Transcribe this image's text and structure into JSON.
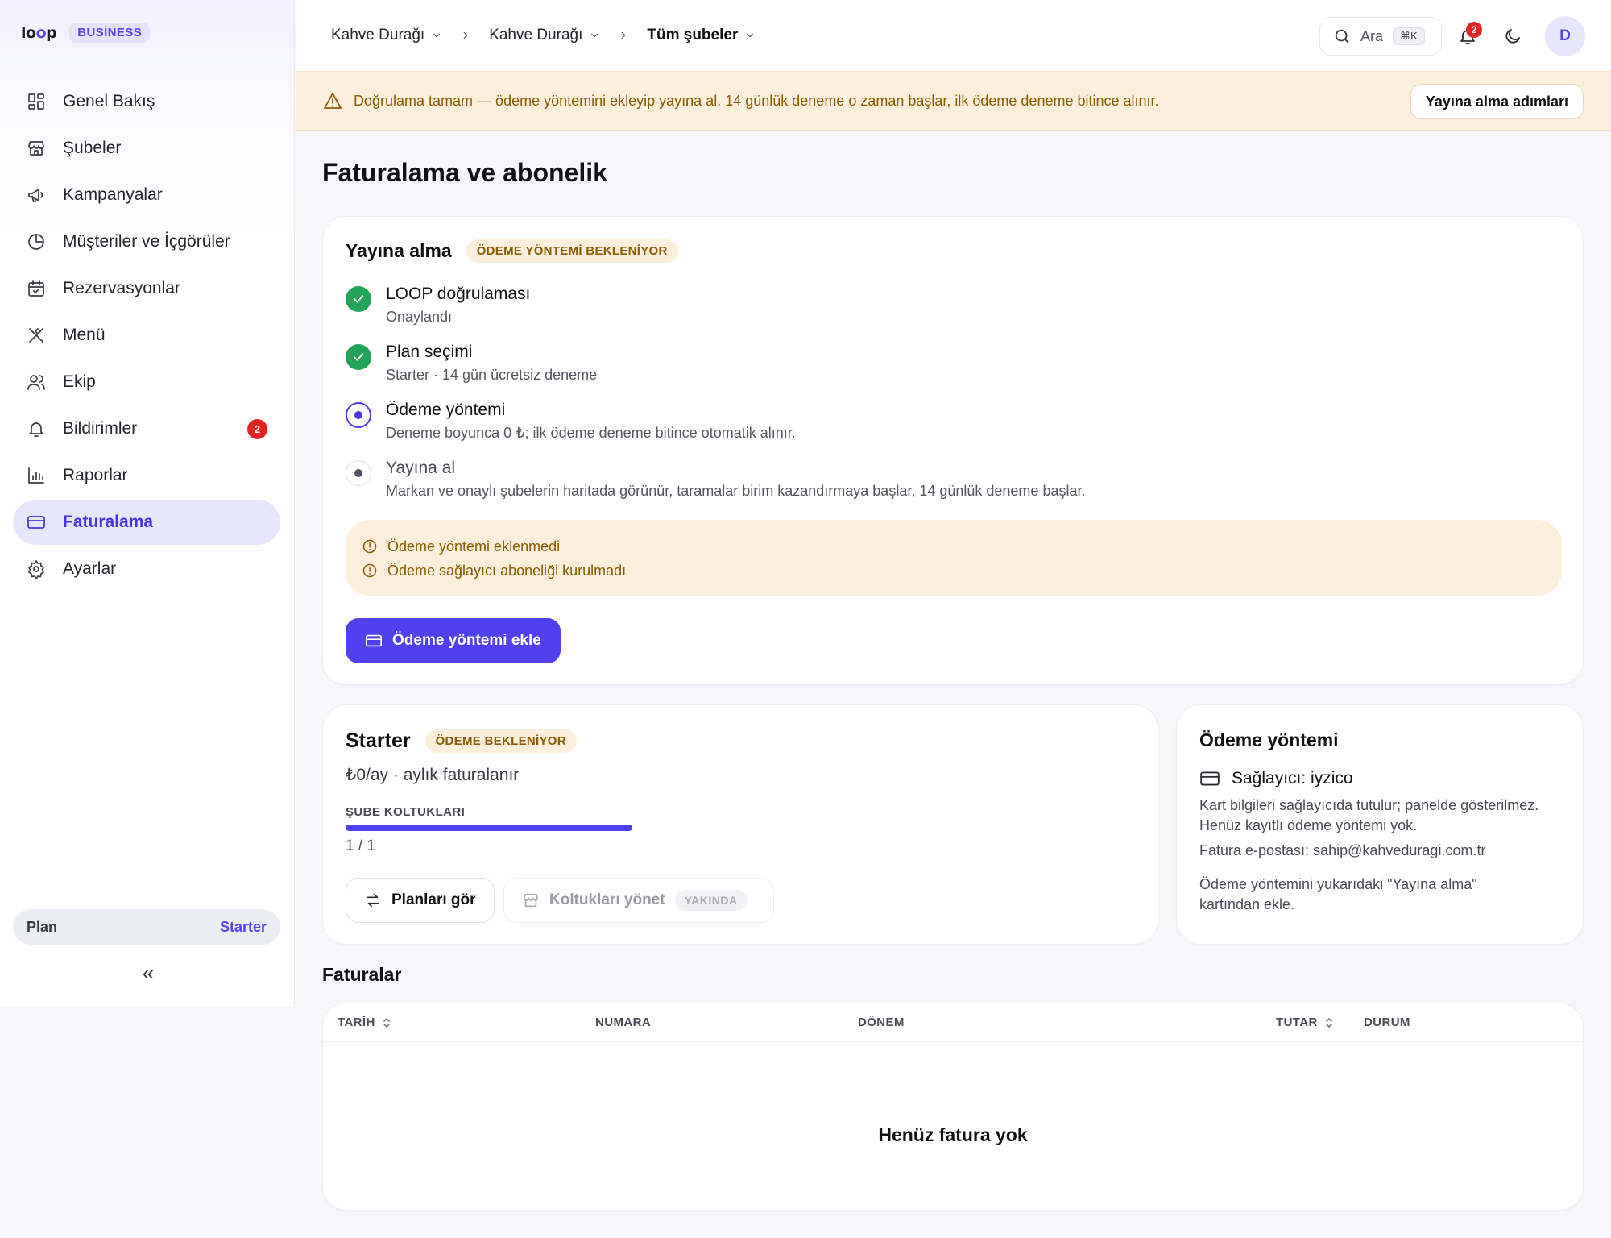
{
  "brand": {
    "logo": "loop",
    "badge": "BUSİNESS"
  },
  "sidebar": {
    "items": [
      {
        "label": "Genel Bakış",
        "icon": "dashboard-icon"
      },
      {
        "label": "Şubeler",
        "icon": "store-icon"
      },
      {
        "label": "Kampanyalar",
        "icon": "megaphone-icon"
      },
      {
        "label": "Müşteriler ve İçgörüler",
        "icon": "pie-chart-icon"
      },
      {
        "label": "Rezervasyonlar",
        "icon": "calendar-check-icon"
      },
      {
        "label": "Menü",
        "icon": "utensils-icon"
      },
      {
        "label": "Ekip",
        "icon": "users-icon"
      },
      {
        "label": "Bildirimler",
        "icon": "bell-icon",
        "badge": "2"
      },
      {
        "label": "Raporlar",
        "icon": "bar-chart-icon"
      },
      {
        "label": "Faturalama",
        "icon": "credit-card-icon",
        "active": true
      },
      {
        "label": "Ayarlar",
        "icon": "gear-icon"
      }
    ],
    "plan_label": "Plan",
    "plan_value": "Starter",
    "collapse_label": "«"
  },
  "topbar": {
    "breadcrumbs": [
      "Kahve Durağı",
      "Kahve Durağı",
      "Tüm şubeler"
    ],
    "search_placeholder": "Ara",
    "search_shortcut": "⌘K",
    "notification_count": "2",
    "avatar_initial": "D"
  },
  "banner": {
    "message": "Doğrulama tamam — ödeme yöntemini ekleyip yayına al. 14 günlük deneme o zaman başlar, ilk ödeme deneme bitince alınır.",
    "button": "Yayına alma adımları"
  },
  "page": {
    "title": "Faturalama ve abonelik"
  },
  "launch": {
    "title": "Yayına alma",
    "status": "ÖDEME YÖNTEMİ BEKLENİYOR",
    "steps": [
      {
        "title": "LOOP doğrulaması",
        "desc": "Onaylandı",
        "state": "done"
      },
      {
        "title": "Plan seçimi",
        "desc": "Starter · 14 gün ücretsiz deneme",
        "state": "done"
      },
      {
        "title": "Ödeme yöntemi",
        "desc": "Deneme boyunca 0 ₺; ilk ödeme deneme bitince otomatik alınır.",
        "state": "current"
      },
      {
        "title": "Yayına al",
        "desc": "Markan ve onaylı şubelerin haritada görünür, taramalar birim kazandırmaya başlar, 14 günlük deneme başlar.",
        "state": "pending"
      }
    ],
    "issues": [
      "Ödeme yöntemi eklenmedi",
      "Ödeme sağlayıcı aboneliği kurulmadı"
    ],
    "cta": "Ödeme yöntemi ekle"
  },
  "plan": {
    "name": "Starter",
    "status": "ÖDEME BEKLENİYOR",
    "price": "₺0/ay · aylık faturalanır",
    "seat_label": "ŞUBE KOLTUKLARI",
    "seat_used": 1,
    "seat_total": 1,
    "seat_text": "1 / 1",
    "view_plans": "Planları gör",
    "manage_seats": "Koltukları yönet",
    "soon": "YAKINDA"
  },
  "payment": {
    "title": "Ödeme yöntemi",
    "provider": "Sağlayıcı: iyzico",
    "note1": "Kart bilgileri sağlayıcıda tutulur; panelde gösterilmez.",
    "note2": "Henüz kayıtlı ödeme yöntemi yok.",
    "email": "Fatura e-postası: sahip@kahveduragi.com.tr",
    "hint": "Ödeme yöntemini yukarıdaki \"Yayına alma\" kartından ekle."
  },
  "invoices": {
    "title": "Faturalar",
    "columns": [
      "TARİH",
      "NUMARA",
      "DÖNEM",
      "TUTAR",
      "DURUM"
    ],
    "empty": "Henüz fatura yok"
  },
  "colors": {
    "accent": "#5140ef",
    "warning_bg": "#fcefdc",
    "warning_text": "#8a5a00",
    "success": "#22a35a",
    "danger": "#e02424"
  }
}
